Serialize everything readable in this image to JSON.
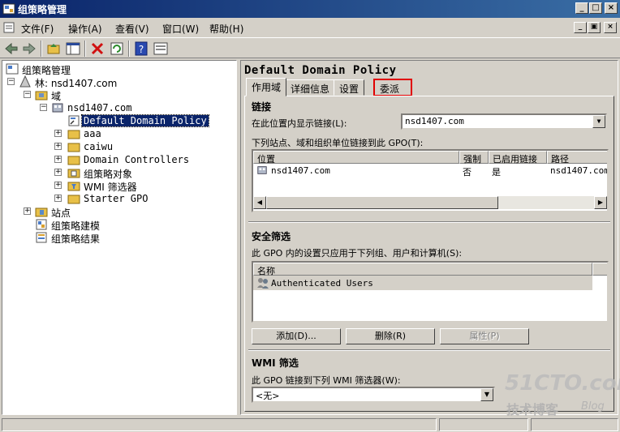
{
  "window": {
    "title": "组策略管理"
  },
  "menu": {
    "items": [
      "文件(F)",
      "操作(A)",
      "查看(V)",
      "窗口(W)",
      "帮助(H)"
    ]
  },
  "tree": {
    "root": "组策略管理",
    "forest": "林: nsd1407.com",
    "domains": "域",
    "domain": "nsd1407.com",
    "selected_gpo": "Default Domain Policy",
    "children": [
      "aaa",
      "caiwu",
      "Domain Controllers",
      "组策略对象",
      "WMI 筛选器",
      "Starter GPO"
    ],
    "sites": "站点",
    "modeling": "组策略建模",
    "results": "组策略结果"
  },
  "details": {
    "title": "Default Domain Policy",
    "tabs": [
      "作用域",
      "详细信息",
      "设置",
      "委派"
    ],
    "links": {
      "header": "链接",
      "display_label": "在此位置内显示链接(L):",
      "display_value": "nsd1407.com",
      "linked_label": "下列站点、域和组织单位链接到此 GPO(T):",
      "columns": [
        "位置",
        "强制",
        "已启用链接",
        "路径"
      ],
      "rows": [
        {
          "location": "nsd1407.com",
          "enforced": "否",
          "enabled": "是",
          "path": "nsd1407.com"
        }
      ]
    },
    "security": {
      "header": "安全筛选",
      "label": "此 GPO 内的设置只应用于下列组、用户和计算机(S):",
      "column": "名称",
      "rows": [
        "Authenticated Users"
      ],
      "add_button": "添加(D)...",
      "remove_button": "删除(R)",
      "properties_button": "属性(P)"
    },
    "wmi": {
      "header": "WMI 筛选",
      "label": "此 GPO 链接到下列 WMI 筛选器(W):",
      "value": "<无>"
    }
  },
  "watermark": {
    "brand": "51CTO.com",
    "tagline": "技术博客",
    "suffix": "Blog"
  },
  "colors": {
    "titlebar_start": "#0a246a",
    "titlebar_end": "#3a6ea5",
    "selection": "#0a246a",
    "highlight_box": "#e00000",
    "face": "#d4d0c8"
  }
}
